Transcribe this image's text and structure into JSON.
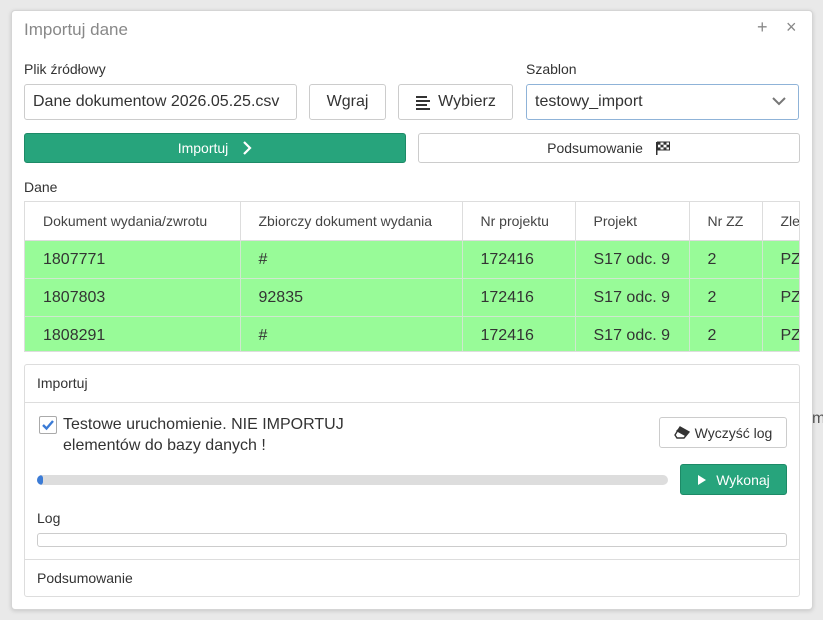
{
  "dialog": {
    "title": "Importuj dane",
    "add_symbol": "+",
    "close_symbol": "×"
  },
  "source": {
    "label": "Plik źródłowy",
    "file_value": "Dane dokumentow 2026.05.25.csv",
    "upload_label": "Wgraj",
    "choose_label": "Wybierz"
  },
  "template": {
    "label": "Szablon",
    "selected": "testowy_import"
  },
  "steps": [
    {
      "label": "Importuj",
      "active": true
    },
    {
      "label": "Podsumowanie",
      "active": false
    }
  ],
  "data": {
    "label": "Dane",
    "columns": [
      "Dokument wydania/zwrotu",
      "Zbiorczy dokument wydania",
      "Nr projektu",
      "Projekt",
      "Nr ZZ",
      "Zle"
    ],
    "rows": [
      [
        "1807771",
        "#",
        "172416",
        "S17 odc. 9",
        "2",
        "PZ"
      ],
      [
        "1807803",
        "92835",
        "172416",
        "S17 odc. 9",
        "2",
        "PZ"
      ],
      [
        "1808291",
        "#",
        "172416",
        "S17 odc. 9",
        "2",
        "PZ"
      ]
    ],
    "row_color": "#98fb98"
  },
  "import_panel": {
    "header": "Importuj",
    "test_run_line1": "Testowe uruchomienie. NIE IMPORTUJ",
    "test_run_line2": "elementów do bazy danych !",
    "test_run_checked": true,
    "clear_log_label": "Wyczyść log",
    "progress_fraction": 0.01,
    "execute_label": "Wykonaj",
    "log_label": "Log",
    "summary_label": "Podsumowanie"
  },
  "backdrop": {
    "fragment": "m"
  },
  "colors": {
    "accent_green": "#27a47c",
    "progress_blue": "#3b7bd6",
    "checkbox_blue": "#3b7bd6"
  }
}
